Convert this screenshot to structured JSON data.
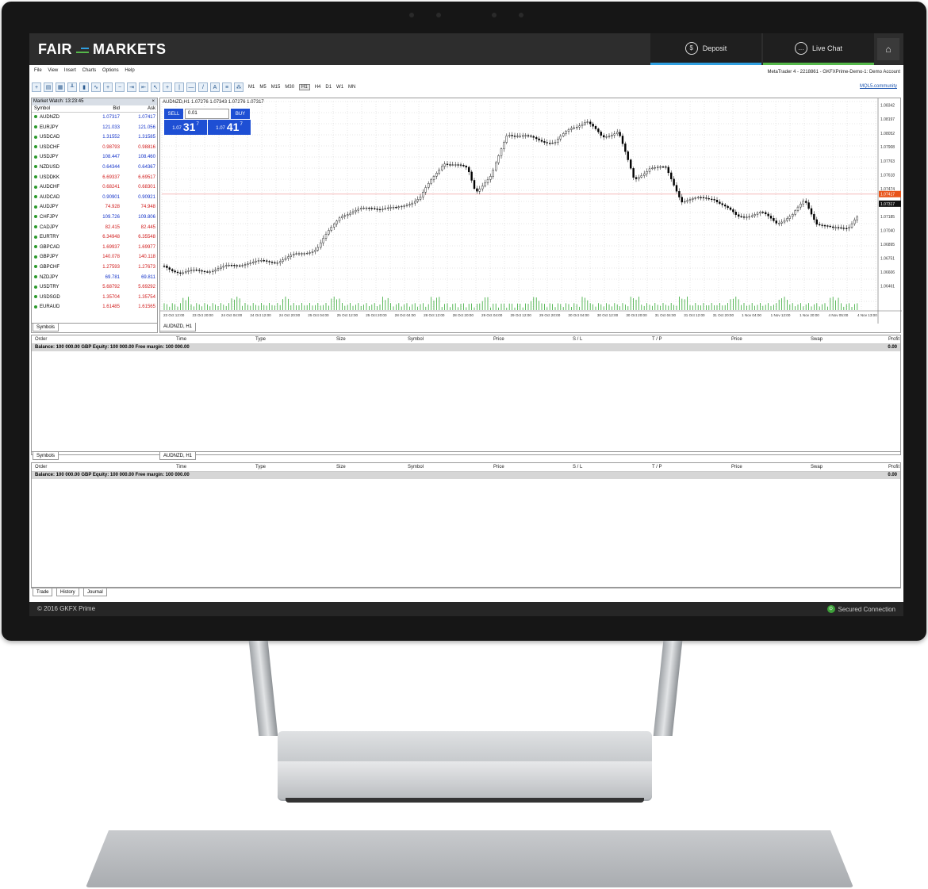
{
  "app": {
    "logo_left": "FAIR",
    "logo_right": "MARKETS",
    "deposit_label": "Deposit",
    "livechat_label": "Live Chat",
    "home_icon": "home-icon"
  },
  "menu": {
    "items": [
      "File",
      "View",
      "Insert",
      "Charts",
      "Options",
      "Help"
    ],
    "account": "MetaTrader 4 - 2218861 - GKFXPrime-Demo-1: Demo Account"
  },
  "toolbar": {
    "timeframes": [
      "M1",
      "M5",
      "M15",
      "M30",
      "H1",
      "H4",
      "D1",
      "W1",
      "MN"
    ],
    "selected_timeframe": "H1",
    "mql_link": "MQL5.community"
  },
  "market_watch": {
    "title": "Market Watch: 13:23:45",
    "columns": [
      "Symbol",
      "Bid",
      "Ask"
    ],
    "rows": [
      {
        "symbol": "AUDNZD",
        "bid": "1.07317",
        "ask": "1.07417",
        "dir": "up"
      },
      {
        "symbol": "EURJPY",
        "bid": "121.033",
        "ask": "121.056",
        "dir": "up"
      },
      {
        "symbol": "USDCAD",
        "bid": "1.31552",
        "ask": "1.31585",
        "dir": "up"
      },
      {
        "symbol": "USDCHF",
        "bid": "0.98793",
        "ask": "0.98816",
        "dir": "dn"
      },
      {
        "symbol": "USDJPY",
        "bid": "108.447",
        "ask": "108.460",
        "dir": "up"
      },
      {
        "symbol": "NZDUSD",
        "bid": "0.64344",
        "ask": "0.64367",
        "dir": "up"
      },
      {
        "symbol": "USDDKK",
        "bid": "6.69337",
        "ask": "6.69517",
        "dir": "dn"
      },
      {
        "symbol": "AUDCHF",
        "bid": "0.68241",
        "ask": "0.68301",
        "dir": "dn"
      },
      {
        "symbol": "AUDCAD",
        "bid": "0.90901",
        "ask": "0.90921",
        "dir": "up"
      },
      {
        "symbol": "AUDJPY",
        "bid": "74.928",
        "ask": "74.948",
        "dir": "dn"
      },
      {
        "symbol": "CHFJPY",
        "bid": "109.726",
        "ask": "109.806",
        "dir": "up"
      },
      {
        "symbol": "CADJPY",
        "bid": "82.415",
        "ask": "82.445",
        "dir": "dn"
      },
      {
        "symbol": "EURTRY",
        "bid": "6.34948",
        "ask": "6.35548",
        "dir": "dn"
      },
      {
        "symbol": "GBPCAD",
        "bid": "1.69937",
        "ask": "1.69977",
        "dir": "dn"
      },
      {
        "symbol": "GBPJPY",
        "bid": "140.078",
        "ask": "140.118",
        "dir": "dn"
      },
      {
        "symbol": "GBPCHF",
        "bid": "1.27593",
        "ask": "1.27673",
        "dir": "dn"
      },
      {
        "symbol": "NZDJPY",
        "bid": "69.781",
        "ask": "69.811",
        "dir": "up"
      },
      {
        "symbol": "USDTRY",
        "bid": "5.68792",
        "ask": "5.69292",
        "dir": "dn"
      },
      {
        "symbol": "USDSGD",
        "bid": "1.35704",
        "ask": "1.35754",
        "dir": "dn"
      },
      {
        "symbol": "EURAUD",
        "bid": "1.61485",
        "ask": "1.61565",
        "dir": "dn"
      }
    ],
    "tab": "Symbols"
  },
  "chart": {
    "label": "AUDNZD,H1  1.07276 1.07343 1.07276 1.07317",
    "tab": "AUDNZD, H1",
    "sell": "SELL",
    "buy": "BUY",
    "lot": "0.01",
    "sell_prefix": "1.07",
    "sell_big": "31",
    "sell_sup": "7",
    "buy_prefix": "1.07",
    "buy_big": "41",
    "buy_sup": "7",
    "price_labels": [
      "1.08342",
      "1.08197",
      "1.08052",
      "1.07908",
      "1.07763",
      "1.07618",
      "1.07474",
      "1.07417",
      "1.07317",
      "1.07185",
      "1.07040",
      "1.06895",
      "1.06751",
      "1.06606",
      "1.06461"
    ],
    "time_labels": [
      "23 Oct 12:00",
      "23 Oct 20:00",
      "24 Oct 04:00",
      "24 Oct 12:00",
      "24 Oct 20:00",
      "25 Oct 04:00",
      "25 Oct 12:00",
      "25 Oct 20:00",
      "28 Oct 04:00",
      "28 Oct 12:00",
      "28 Oct 20:00",
      "29 Oct 04:00",
      "29 Oct 12:00",
      "29 Oct 20:00",
      "30 Oct 04:00",
      "30 Oct 12:00",
      "30 Oct 20:00",
      "31 Oct 04:00",
      "31 Oct 12:00",
      "31 Oct 20:00",
      "1 Nov 04:00",
      "1 Nov 12:00",
      "1 Nov 20:00",
      "4 Nov 05:00",
      "4 Nov 13:00"
    ],
    "ask_line_color": "#f0a0a0",
    "ask_tag_color": "#e8541a",
    "bid_tag_color": "#111111",
    "volume_color": "#33a833"
  },
  "terminal": {
    "columns": [
      "Order",
      "Time",
      "Type",
      "Size",
      "Symbol",
      "Price",
      "S / L",
      "T / P",
      "Price",
      "Swap",
      "Profit"
    ],
    "balance": "Balance: 100 000.00 GBP  Equity: 100 000.00  Free margin: 100 000.00",
    "profit": "0.00",
    "symbols_tab": "Symbols",
    "chart_tab": "AUDNZD, H1",
    "tabs": [
      "Trade",
      "History",
      "Journal"
    ]
  },
  "footer": {
    "copyright": "© 2016 GKFX Prime",
    "secure": "Secured Connection"
  }
}
